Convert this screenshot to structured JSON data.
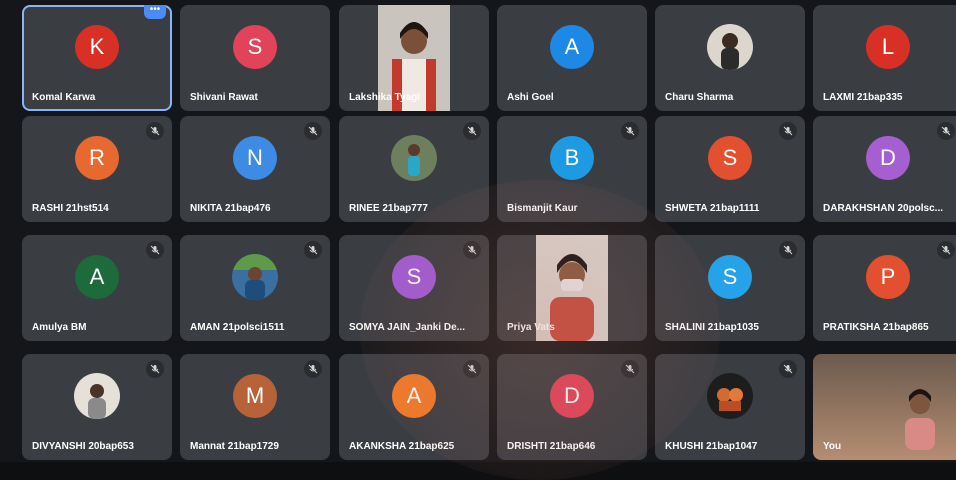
{
  "tiles": [
    {
      "name": "Komal Karwa",
      "initial": "K",
      "color": "#d93025",
      "kind": "avatar",
      "active": true,
      "more": true
    },
    {
      "name": "Shivani Rawat",
      "initial": "S",
      "color": "#e0435a",
      "kind": "avatar"
    },
    {
      "name": "Lakshika Tyagi",
      "kind": "video",
      "video": "lakshika"
    },
    {
      "name": "Ashi Goel",
      "initial": "A",
      "color": "#1e88e5",
      "kind": "avatar"
    },
    {
      "name": "Charu Sharma",
      "kind": "photo",
      "photo": "charu"
    },
    {
      "name": "LAXMI 21bap335",
      "initial": "L",
      "color": "#d93025",
      "kind": "avatar"
    },
    {
      "name": "RASHI 21hst514",
      "initial": "R",
      "color": "#e8692f",
      "kind": "avatar",
      "mic": true
    },
    {
      "name": "NIKITA 21bap476",
      "initial": "N",
      "color": "#3d8be2",
      "kind": "avatar",
      "mic": true
    },
    {
      "name": "RINEE 21bap777",
      "kind": "photo",
      "photo": "rinee",
      "mic": true
    },
    {
      "name": "Bismanjit Kaur",
      "initial": "B",
      "color": "#1e9ae3",
      "kind": "avatar",
      "mic": true
    },
    {
      "name": "SHWETA 21bap1111",
      "initial": "S",
      "color": "#e3502f",
      "kind": "avatar",
      "mic": true
    },
    {
      "name": "DARAKHSHAN 20polsc...",
      "initial": "D",
      "color": "#a55fd0",
      "kind": "avatar",
      "mic": true
    },
    {
      "name": "Amulya BM",
      "initial": "A",
      "color": "#1d6b3a",
      "kind": "avatar",
      "mic": true
    },
    {
      "name": "AMAN 21polsci1511",
      "kind": "photo",
      "photo": "aman",
      "mic": true
    },
    {
      "name": "SOMYA JAIN_Janki De...",
      "initial": "S",
      "color": "#a05bd6",
      "kind": "avatar",
      "mic": true
    },
    {
      "name": "Priya Vats",
      "kind": "video",
      "video": "priya"
    },
    {
      "name": "SHALINI 21bap1035",
      "initial": "S",
      "color": "#26a3e8",
      "kind": "avatar",
      "mic": true
    },
    {
      "name": "PRATIKSHA 21bap865",
      "initial": "P",
      "color": "#e3502f",
      "kind": "avatar",
      "mic": true
    },
    {
      "name": "DIVYANSHI 20bap653",
      "kind": "photo",
      "photo": "divyanshi",
      "mic": true
    },
    {
      "name": "Mannat 21bap1729",
      "initial": "M",
      "color": "#b8623a",
      "kind": "avatar",
      "mic": true
    },
    {
      "name": "AKANKSHA 21bap625",
      "initial": "A",
      "color": "#f07a28",
      "kind": "avatar",
      "mic": true
    },
    {
      "name": "DRISHTI 21bap646",
      "initial": "D",
      "color": "#e0435a",
      "kind": "avatar",
      "mic": true
    },
    {
      "name": "KHUSHI 21bap1047",
      "kind": "photo",
      "photo": "khushi",
      "mic": true
    },
    {
      "name": "You",
      "kind": "self"
    }
  ],
  "icons": {
    "mic": "mic-off-icon",
    "more": "more-options-icon"
  }
}
